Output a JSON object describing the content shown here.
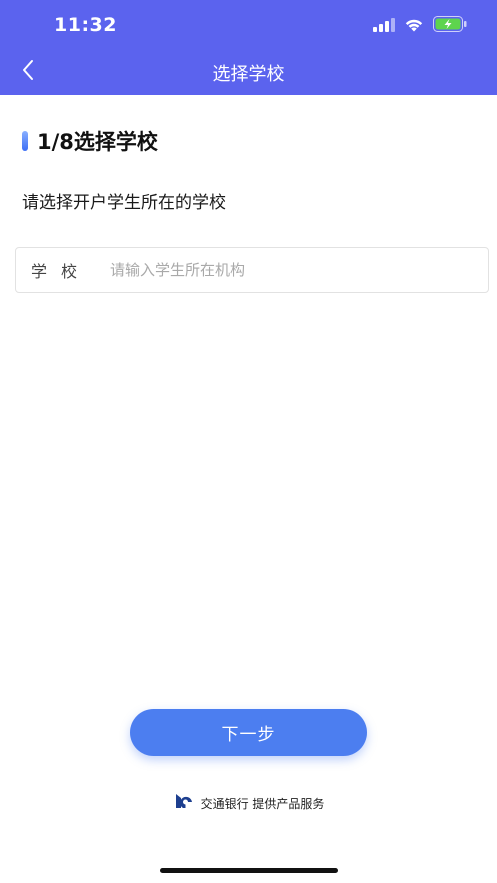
{
  "status_bar": {
    "time": "11:32",
    "icons": [
      "cellular-signal-icon",
      "wifi-icon",
      "battery-charging-icon"
    ]
  },
  "nav": {
    "title": "选择学校",
    "back_icon": "chevron-left-icon"
  },
  "step": {
    "title": "1/8选择学校"
  },
  "instruction": "请选择开户学生所在的学校",
  "school_field": {
    "label": "学校",
    "value": "",
    "placeholder": "请输入学生所在机构"
  },
  "next_button": {
    "label": "下一步"
  },
  "footer": {
    "provider_text": "交通银行 提供产品服务",
    "logo_icon": "bank-of-communications-logo-icon"
  },
  "colors": {
    "header_bg": "#5b63ee",
    "accent": "#4c7ef0",
    "battery": "#5ed44e"
  }
}
